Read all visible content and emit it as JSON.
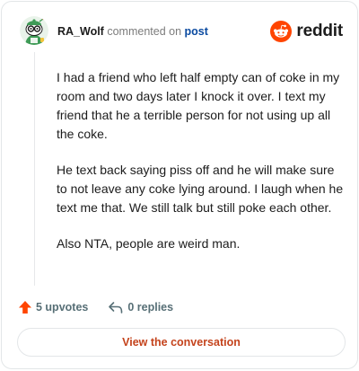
{
  "header": {
    "username": "RA_Wolf",
    "action_text": "commented on",
    "post_link": "post",
    "brand": "reddit"
  },
  "comment": {
    "paragraphs": [
      "I had a friend who left half empty can of coke in my room and two days later I knock it over. I text my friend that he a terrible person for not using up all the coke.",
      "He text back saying piss off and he will make sure to not leave any coke lying around. I laugh when he text me that. We still talk but still poke each other.",
      "Also NTA, people are weird man."
    ]
  },
  "actions": {
    "upvotes": "5 upvotes",
    "replies": "0 replies"
  },
  "cta": {
    "label": "View the conversation"
  },
  "colors": {
    "upvote_orange": "#ff4500",
    "link_blue": "#0a4aa0",
    "cta_text": "#c4431c",
    "muted_text": "#576f76"
  },
  "icons": {
    "avatar": "snoo-avatar-icon",
    "logo": "reddit-logo-icon",
    "upvote": "upvote-arrow-icon",
    "reply": "reply-arrow-icon"
  }
}
